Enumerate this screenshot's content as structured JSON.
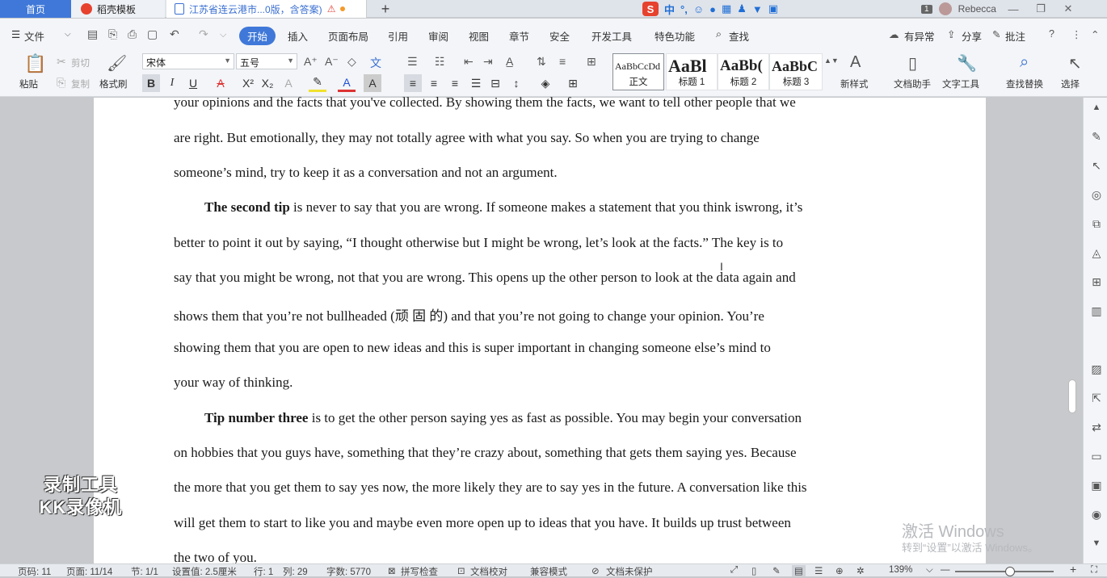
{
  "tabs": {
    "home": "首页",
    "template": "稻壳模板",
    "document": "江苏省连云港市...0版，含答案)",
    "add": "+"
  },
  "ime": {
    "mode": "中",
    "punct": "°,"
  },
  "user": {
    "count": "1",
    "name": "Rebecca"
  },
  "menu": {
    "file": "文件",
    "start": "开始",
    "insert": "插入",
    "layout": "页面布局",
    "references": "引用",
    "review": "审阅",
    "view": "视图",
    "section": "章节",
    "security": "安全",
    "devtools": "开发工具",
    "features": "特色功能",
    "search": "查找",
    "status_abnormal": "有异常",
    "share": "分享",
    "comment": "批注"
  },
  "ribbon": {
    "paste": "粘贴",
    "cut": "剪切",
    "copy": "复制",
    "format_painter": "格式刷",
    "font_name": "宋体",
    "font_size": "五号",
    "styles": [
      {
        "sample": "AaBbCcDd",
        "name": "正文"
      },
      {
        "sample": "AaBl",
        "name": "标题 1"
      },
      {
        "sample": "AaBb(",
        "name": "标题 2"
      },
      {
        "sample": "AaBbC",
        "name": "标题 3"
      }
    ],
    "new_style": "新样式",
    "doc_assistant": "文档助手",
    "text_tools": "文字工具",
    "find_replace": "查找替换",
    "select": "选择"
  },
  "document": {
    "lines": [
      "your opinions and the facts that you've collected. By showing them the facts, we want to tell other people that we",
      "are right. But emotionally, they may not totally agree with what you say. So when you are trying to change",
      "someone’s mind, try to keep it as a conversation and not an argument.",
      "is never to say that you are wrong. If someone makes a statement that you think iswrong, it’s",
      "better to point it out by saying, “I thought otherwise but I might be wrong, let’s look at the facts.” The key is to",
      "say that you might be wrong, not that you are wrong. This opens up the other person to look at the data again and",
      "shows them that you’re not bullheaded (顽 固 的) and that you’re not going to change your opinion. You’re",
      "showing them that you are open to new ideas and this is super important in changing someone else’s mind to",
      "your way of thinking.",
      "is to get the other person saying yes as fast as possible. You may begin your conversation",
      "on hobbies that you guys have, something that they’re crazy about, something that gets them saying yes. Because",
      "the more that you get them to say yes now, the more likely they are to say yes in the future. A conversation like this",
      " will get them to start to like you and maybe even more open up to ideas that you have. It builds up trust between",
      " the two of you."
    ],
    "bold_second": "The second tip",
    "bold_third": "Tip number three"
  },
  "watermark": {
    "line1": "录制工具",
    "line2": "KK录像机"
  },
  "activation": {
    "title": "激活 Windows",
    "subtitle": "转到“设置”以激活 Windows。"
  },
  "status": {
    "page_no": "页码: 11",
    "page": "页面: 11/14",
    "section": "节: 1/1",
    "setting": "设置值: 2.5厘米",
    "row": "行: 1",
    "col": "列: 29",
    "words": "字数: 5770",
    "spell": "拼写检查",
    "proof": "文档校对",
    "compat": "兼容模式",
    "protect": "文档未保护",
    "zoom": "139%"
  },
  "colors": {
    "accent": "#3f78d8",
    "tab_bg": "#dfe3ea",
    "ribbon_bg": "#f3f5f8"
  }
}
